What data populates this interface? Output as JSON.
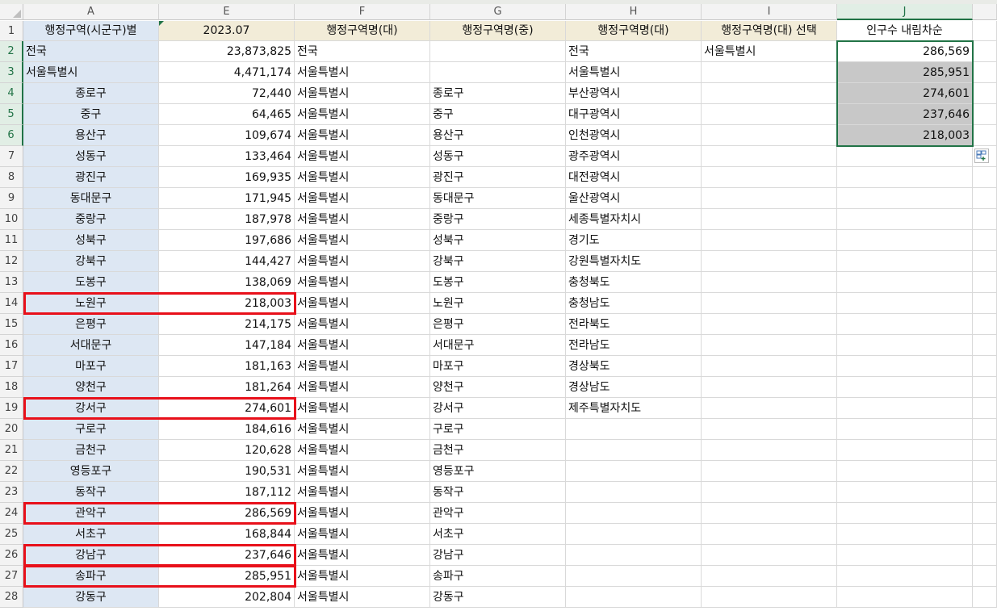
{
  "columns": [
    "A",
    "E",
    "F",
    "G",
    "H",
    "I",
    "J"
  ],
  "rows": [
    {
      "n": "1",
      "a": "행정구역(시군구)별",
      "e": "2023.07",
      "f": "행정구역명(대)",
      "g": "행정구역명(중)",
      "h": "행정구역명(대)",
      "i": "행정구역명(대) 선택",
      "j": "인구수 내림차순"
    },
    {
      "n": "2",
      "a": "전국",
      "e": "23,873,825",
      "f": "전국",
      "g": "",
      "h": "전국",
      "i": "서울특별시",
      "j": "286,569"
    },
    {
      "n": "3",
      "a": "서울특별시",
      "e": "4,471,174",
      "f": "서울특별시",
      "g": "",
      "h": "서울특별시",
      "i": "",
      "j": "285,951"
    },
    {
      "n": "4",
      "a": "종로구",
      "e": "72,440",
      "f": "서울특별시",
      "g": "종로구",
      "h": "부산광역시",
      "i": "",
      "j": "274,601"
    },
    {
      "n": "5",
      "a": "중구",
      "e": "64,465",
      "f": "서울특별시",
      "g": "중구",
      "h": "대구광역시",
      "i": "",
      "j": "237,646"
    },
    {
      "n": "6",
      "a": "용산구",
      "e": "109,674",
      "f": "서울특별시",
      "g": "용산구",
      "h": "인천광역시",
      "i": "",
      "j": "218,003"
    },
    {
      "n": "7",
      "a": "성동구",
      "e": "133,464",
      "f": "서울특별시",
      "g": "성동구",
      "h": "광주광역시",
      "i": "",
      "j": ""
    },
    {
      "n": "8",
      "a": "광진구",
      "e": "169,935",
      "f": "서울특별시",
      "g": "광진구",
      "h": "대전광역시",
      "i": "",
      "j": ""
    },
    {
      "n": "9",
      "a": "동대문구",
      "e": "171,945",
      "f": "서울특별시",
      "g": "동대문구",
      "h": "울산광역시",
      "i": "",
      "j": ""
    },
    {
      "n": "10",
      "a": "중랑구",
      "e": "187,978",
      "f": "서울특별시",
      "g": "중랑구",
      "h": "세종특별자치시",
      "i": "",
      "j": ""
    },
    {
      "n": "11",
      "a": "성북구",
      "e": "197,686",
      "f": "서울특별시",
      "g": "성북구",
      "h": "경기도",
      "i": "",
      "j": ""
    },
    {
      "n": "12",
      "a": "강북구",
      "e": "144,427",
      "f": "서울특별시",
      "g": "강북구",
      "h": "강원특별자치도",
      "i": "",
      "j": ""
    },
    {
      "n": "13",
      "a": "도봉구",
      "e": "138,069",
      "f": "서울특별시",
      "g": "도봉구",
      "h": "충청북도",
      "i": "",
      "j": ""
    },
    {
      "n": "14",
      "a": "노원구",
      "e": "218,003",
      "f": "서울특별시",
      "g": "노원구",
      "h": "충청남도",
      "i": "",
      "j": ""
    },
    {
      "n": "15",
      "a": "은평구",
      "e": "214,175",
      "f": "서울특별시",
      "g": "은평구",
      "h": "전라북도",
      "i": "",
      "j": ""
    },
    {
      "n": "16",
      "a": "서대문구",
      "e": "147,184",
      "f": "서울특별시",
      "g": "서대문구",
      "h": "전라남도",
      "i": "",
      "j": ""
    },
    {
      "n": "17",
      "a": "마포구",
      "e": "181,163",
      "f": "서울특별시",
      "g": "마포구",
      "h": "경상북도",
      "i": "",
      "j": ""
    },
    {
      "n": "18",
      "a": "양천구",
      "e": "181,264",
      "f": "서울특별시",
      "g": "양천구",
      "h": "경상남도",
      "i": "",
      "j": ""
    },
    {
      "n": "19",
      "a": "강서구",
      "e": "274,601",
      "f": "서울특별시",
      "g": "강서구",
      "h": "제주특별자치도",
      "i": "",
      "j": ""
    },
    {
      "n": "20",
      "a": "구로구",
      "e": "184,616",
      "f": "서울특별시",
      "g": "구로구",
      "h": "",
      "i": "",
      "j": ""
    },
    {
      "n": "21",
      "a": "금천구",
      "e": "120,628",
      "f": "서울특별시",
      "g": "금천구",
      "h": "",
      "i": "",
      "j": ""
    },
    {
      "n": "22",
      "a": "영등포구",
      "e": "190,531",
      "f": "서울특별시",
      "g": "영등포구",
      "h": "",
      "i": "",
      "j": ""
    },
    {
      "n": "23",
      "a": "동작구",
      "e": "187,112",
      "f": "서울특별시",
      "g": "동작구",
      "h": "",
      "i": "",
      "j": ""
    },
    {
      "n": "24",
      "a": "관악구",
      "e": "286,569",
      "f": "서울특별시",
      "g": "관악구",
      "h": "",
      "i": "",
      "j": ""
    },
    {
      "n": "25",
      "a": "서초구",
      "e": "168,844",
      "f": "서울특별시",
      "g": "서초구",
      "h": "",
      "i": "",
      "j": ""
    },
    {
      "n": "26",
      "a": "강남구",
      "e": "237,646",
      "f": "서울특별시",
      "g": "강남구",
      "h": "",
      "i": "",
      "j": ""
    },
    {
      "n": "27",
      "a": "송파구",
      "e": "285,951",
      "f": "서울특별시",
      "g": "송파구",
      "h": "",
      "i": "",
      "j": ""
    },
    {
      "n": "28",
      "a": "강동구",
      "e": "202,804",
      "f": "서울특별시",
      "g": "강동구",
      "h": "",
      "i": "",
      "j": ""
    }
  ],
  "highlighted_rows": [
    "14",
    "19",
    "24",
    "26",
    "27"
  ],
  "selection": {
    "column": "J",
    "rows": [
      "2",
      "3",
      "4",
      "5",
      "6"
    ]
  },
  "colors": {
    "accent": "#217346",
    "highlight": "#e8101a",
    "header_fill": "#f2ecd8",
    "label_fill": "#dde7f3",
    "selected_fill": "#c8c8c8"
  }
}
